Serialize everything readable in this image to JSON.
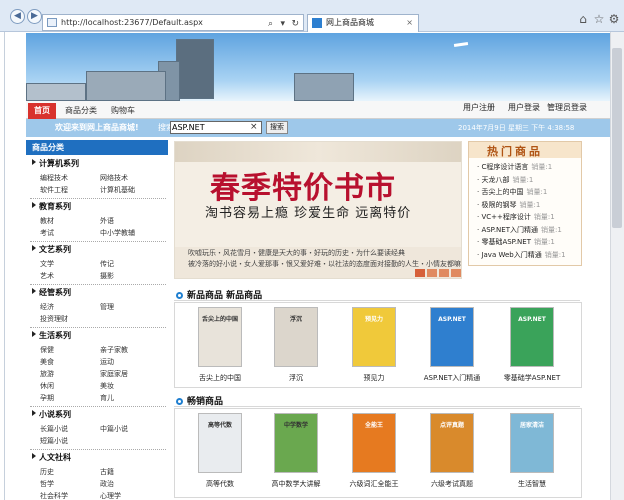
{
  "browser": {
    "url": "http://localhost:23677/Default.aspx",
    "tab_title": "网上商品商城",
    "back_glyph": "◀",
    "forward_glyph": "▶"
  },
  "nav": {
    "tabs": [
      "首页",
      "商品分类",
      "购物车"
    ],
    "links": [
      "用户注册",
      "用户登录",
      "管理员登录"
    ]
  },
  "welcome": {
    "text": "欢迎来到网上商品商城!",
    "search_label": "搜索",
    "search_value": "ASP.NET",
    "search_button": "搜索",
    "datetime": "2014年7月9日 星期三 下午 4:38:58"
  },
  "sidebar": {
    "title": "商品分类",
    "categories": [
      {
        "name": "计算机系列",
        "subs": [
          "编程技术",
          "网络技术",
          "软件工程",
          "计算机基础"
        ]
      },
      {
        "name": "教育系列",
        "subs": [
          "教材",
          "外语",
          "考试",
          "中小学教辅"
        ]
      },
      {
        "name": "文艺系列",
        "subs": [
          "文学",
          "传记",
          "艺术",
          "摄影"
        ]
      },
      {
        "name": "经管系列",
        "subs": [
          "经济",
          "管理",
          "投资理财"
        ]
      },
      {
        "name": "生活系列",
        "subs": [
          "保健",
          "亲子家教",
          "美食",
          "运动",
          "旅游",
          "家庭家居",
          "休闲",
          "美妆",
          "孕期",
          "育儿"
        ]
      },
      {
        "name": "小说系列",
        "subs": [
          "长篇小说",
          "中篇小说",
          "短篇小说"
        ]
      },
      {
        "name": "人文社科",
        "subs": [
          "历史",
          "古籍",
          "哲学",
          "政治",
          "社会科学",
          "心理学"
        ]
      }
    ]
  },
  "promo": {
    "title": "春季特价书市",
    "subtitle": "淘书容易上瘾  珍爱生命  远离特价",
    "line1": "吹嘘玩乐・风花雪月・健康是天大的事・好玩的历史・为什么要读经典",
    "line2": "被冷落的好小说・女人爱那事・恨又爱好难・以社法的态度面对接勤的人生・小情友都嘛"
  },
  "hot": {
    "title": "热门商品",
    "sold_label": "销量:",
    "items": [
      {
        "name": "C程序设计语言",
        "sales": "1"
      },
      {
        "name": "天龙八部",
        "sales": "1"
      },
      {
        "name": "舌尖上的中国",
        "sales": "1"
      },
      {
        "name": "极限的钢琴",
        "sales": "1"
      },
      {
        "name": "VC++程序设计",
        "sales": "1"
      },
      {
        "name": "ASP.NET入门精通",
        "sales": "1"
      },
      {
        "name": "零基础ASP.NET",
        "sales": "1"
      },
      {
        "name": "Java Web入门精通",
        "sales": "1"
      }
    ]
  },
  "new_products": {
    "title": "新品商品",
    "title_repeat": "新品商品",
    "items": [
      {
        "title": "舌尖上的中国",
        "cover": "舌尖上的中国",
        "color": "#e8e3da"
      },
      {
        "title": "浮沉",
        "cover": "浮沉",
        "color": "#dcd6cc"
      },
      {
        "title": "预见力",
        "cover": "预见力",
        "color": "#f0c93a"
      },
      {
        "title": "ASP.NET入门精通",
        "cover": "ASP.NET",
        "color": "#2f7fcf"
      },
      {
        "title": "零基础学ASP.NET",
        "cover": "ASP.NET",
        "color": "#3aa35a"
      }
    ]
  },
  "best_sellers": {
    "title": "畅销商品",
    "items": [
      {
        "title": "高等代数",
        "cover": "高等代数",
        "color": "#e9ecef"
      },
      {
        "title": "高中数学大讲解",
        "cover": "中学数学",
        "color": "#6aa84f"
      },
      {
        "title": "六级词汇全能王",
        "cover": "全能王",
        "color": "#e67a20"
      },
      {
        "title": "六级考试真题",
        "cover": "点评真题",
        "color": "#d98a2c"
      },
      {
        "title": "生活智慧",
        "cover": "居家清洁",
        "color": "#7fb8d6"
      }
    ]
  }
}
